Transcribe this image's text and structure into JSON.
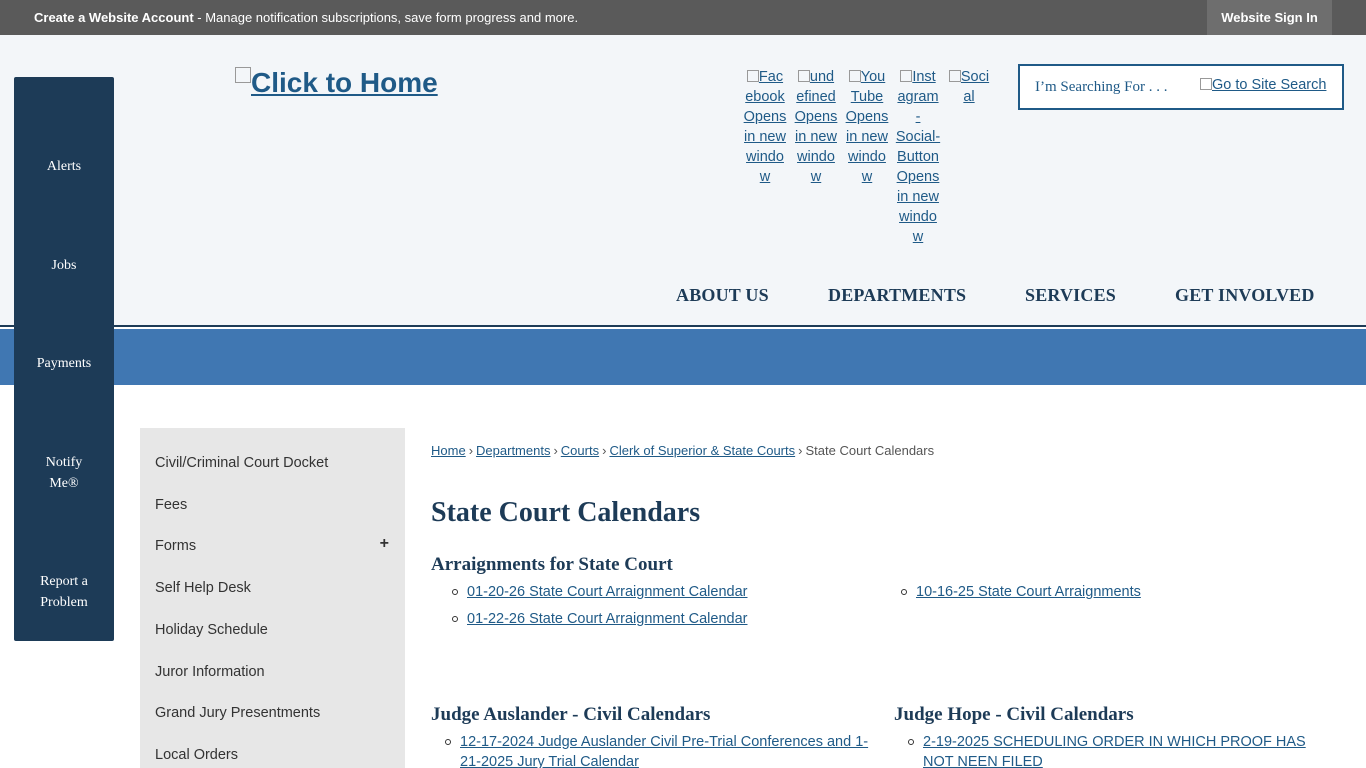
{
  "topbar": {
    "account_bold": "Create a Website Account",
    "account_rest": " - Manage notification subscriptions, save form progress and more.",
    "sign_in": "Website Sign In"
  },
  "header": {
    "logo_alt": "Click to Home",
    "social": [
      {
        "label": "Facebook Opens in new window",
        "lines": [
          "Fac",
          "ebook",
          "Opens",
          "in new",
          "windo",
          "w"
        ]
      },
      {
        "label": "undefined Opens in new window",
        "lines": [
          "und",
          "efined",
          "Opens",
          "in new",
          "windo",
          "w"
        ]
      },
      {
        "label": "YouTube Opens in new window",
        "lines": [
          "You",
          "Tube",
          "Opens",
          "in new",
          "windo",
          "w"
        ]
      },
      {
        "label": "Instagram - Social-Button Opens in new window",
        "lines": [
          "Inst",
          "agram",
          "-",
          "Social-",
          "Button",
          "Opens",
          "in new",
          "windo",
          "w"
        ]
      },
      {
        "label": "Social",
        "lines": [
          "Soci",
          "al"
        ]
      }
    ],
    "search_placeholder": "I’m Searching For . . .",
    "search_button_alt": "Go to Site Search",
    "nav": [
      "ABOUT US",
      "DEPARTMENTS",
      "SERVICES",
      "GET INVOLVED"
    ]
  },
  "quick_links": [
    {
      "lines": [
        "Alerts"
      ]
    },
    {
      "lines": [
        "Jobs"
      ]
    },
    {
      "lines": [
        "Payments"
      ]
    },
    {
      "lines": [
        "Notify",
        "Me®"
      ]
    },
    {
      "lines": [
        "Report a",
        "Problem"
      ]
    }
  ],
  "subnav": [
    {
      "label": "Civil/Criminal Court Docket"
    },
    {
      "label": "Fees"
    },
    {
      "label": "Forms",
      "expand": "+"
    },
    {
      "label": "Self Help Desk"
    },
    {
      "label": "Holiday Schedule"
    },
    {
      "label": "Juror Information"
    },
    {
      "label": "Grand Jury Presentments"
    },
    {
      "label": "Local Orders"
    }
  ],
  "breadcrumb": {
    "links": [
      "Home",
      "Departments",
      "Courts",
      "Clerk of Superior & State Courts"
    ],
    "current": "State Court Calendars",
    "separator": "›"
  },
  "page_title": "State Court Calendars",
  "sections": {
    "arraignments": {
      "heading": "Arraignments for State Court",
      "left_links": [
        "01-20-26 State Court Arraignment Calendar",
        "01-22-26 State Court Arraignment Calendar"
      ],
      "right_links": [
        "10-16-25 State Court Arraignments"
      ]
    },
    "auslander": {
      "heading": "Judge Auslander - Civil Calendars",
      "link_line1": "12-17-2024 Judge Auslander Civil Pre-Trial Conferences and 1-",
      "link_line2": "21-2025 Jury Trial Calendar"
    },
    "hope": {
      "heading": "Judge Hope - Civil Calendars",
      "link_line1": "2-19-2025 SCHEDULING ORDER IN WHICH PROOF HAS",
      "link_line2": "NOT NEEN FILED"
    }
  },
  "colors": {
    "topbar": "#5a5a5a",
    "header_bg": "#f3f6f9",
    "navy": "#1d3b57",
    "band_blue": "#4077b2",
    "link": "#1f5a87",
    "subnav_bg": "#e7e7e7"
  }
}
